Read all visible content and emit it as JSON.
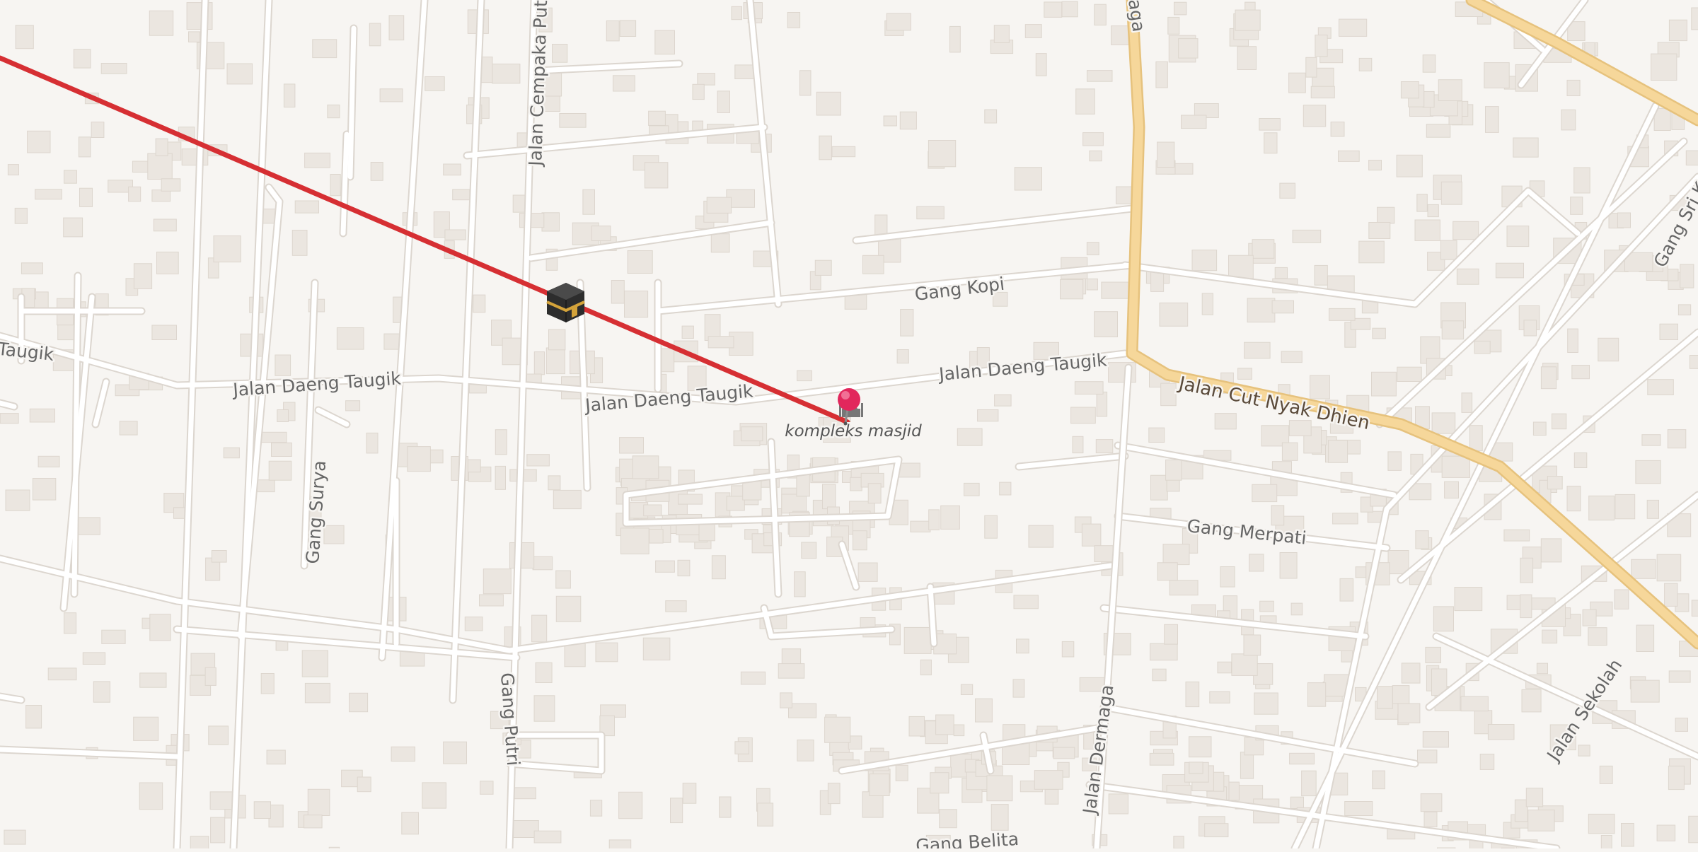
{
  "map": {
    "road_labels": {
      "cempaka": "Jalan Cempaka Putih",
      "daeng_w": "Taugik",
      "daeng_1": "Jalan Daeng Taugik",
      "daeng_2": "Jalan Daeng Taugik",
      "daeng_3": "Jalan Daeng Taugik",
      "kopi": "Gang Kopi",
      "surya": "Gang Surya",
      "putri": "Gang Putri",
      "cut_nyak": "Jalan Cut Nyak Dhien",
      "merpati": "Gang Merpati",
      "dermaga_top": "aga",
      "dermaga": "Jalan Dermaga",
      "sekolah": "Jalan Sekolah",
      "sri": "Gang Sri K",
      "belita": "Gang Belita"
    },
    "poi": {
      "name": "kompleks masjid",
      "icon": "mosque-icon"
    },
    "markers": {
      "pin": "location-pin-icon",
      "kaaba": "kaaba-icon"
    },
    "colors": {
      "background": "#f7f5f2",
      "road": "#ffffff",
      "main_road": "#f6d79a",
      "qibla_line": "#d62f33",
      "pin": "#e2275c"
    }
  }
}
